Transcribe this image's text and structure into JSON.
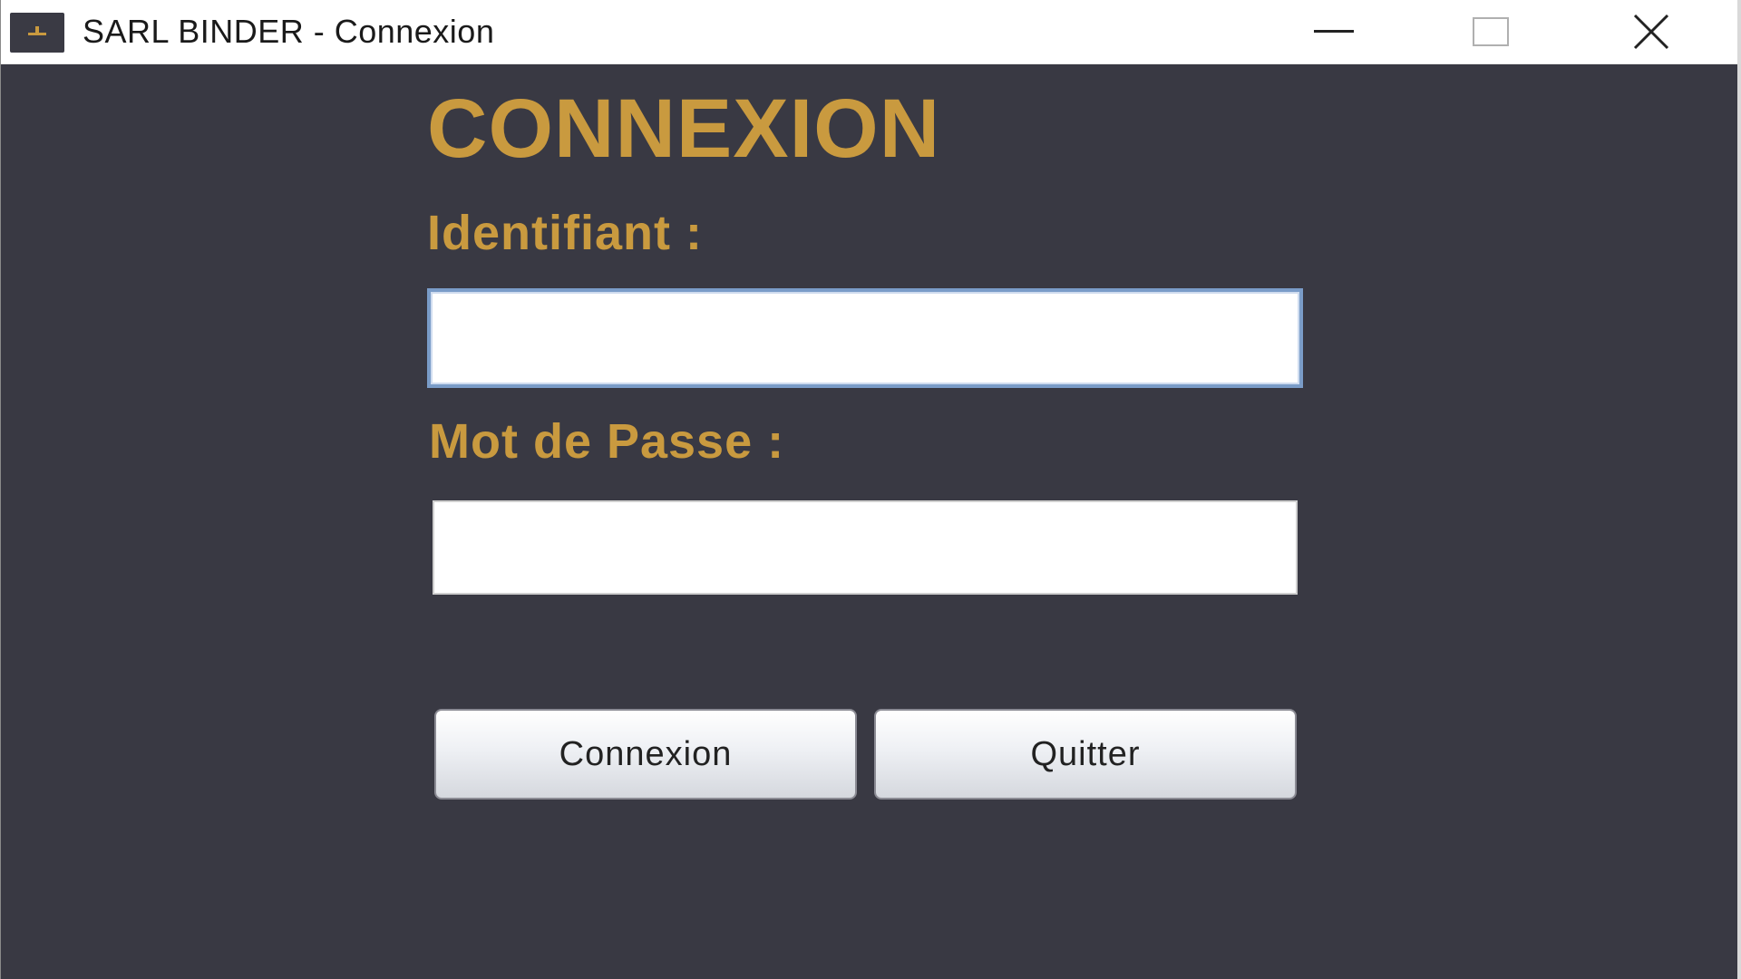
{
  "window": {
    "title": "SARL BINDER - Connexion",
    "icon": "app-icon",
    "controls": {
      "minimize_icon": "minimize-icon",
      "maximize_icon": "maximize-icon",
      "close_icon": "close-icon"
    }
  },
  "form": {
    "title": "CONNEXION",
    "identifiant_label": "Identifiant :",
    "identifiant_value": "",
    "password_label": "Mot de Passe :",
    "password_value": "",
    "connexion_button": "Connexion",
    "quitter_button": "Quitter"
  },
  "colors": {
    "background": "#393943",
    "accent": "#c99a3f",
    "focus_border": "#7a9cc8"
  }
}
